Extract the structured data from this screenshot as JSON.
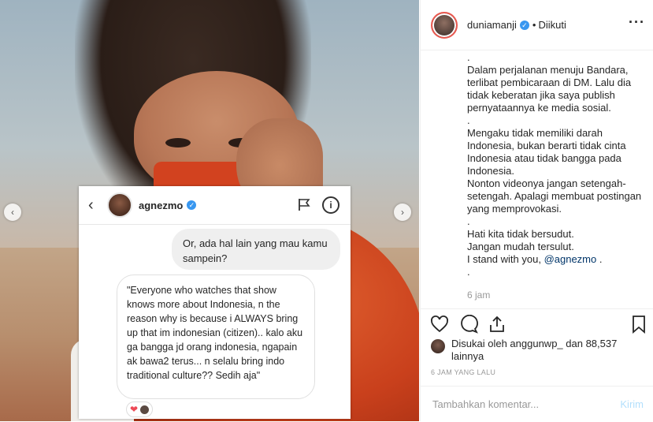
{
  "dm_screenshot": {
    "username": "agnezmo",
    "outgoing_message": "Or, ada hal lain yang mau kamu sampein?",
    "incoming_message": "\"Everyone who watches that show knows more about Indonesia, n the reason why is because i ALWAYS bring up that im indonesian (citizen).. kalo aku ga bangga jd orang indonesia, ngapain ak bawa2 terus... n selalu bring indo traditional culture?? Sedih aja\"",
    "icons": [
      "chevron-left-icon",
      "flag-icon",
      "info-icon",
      "heart-icon"
    ]
  },
  "post_header": {
    "username": "duniamanji",
    "separator": "•",
    "follow_status": "Diikuti",
    "more": "···"
  },
  "caption": {
    "text": ".\nDalam perjalanan menuju Bandara, terlibat pembicaraan di DM. Lalu dia tidak keberatan jika saya publish pernyataannya ke media sosial.\n.\nMengaku tidak memiliki darah Indonesia, bukan berarti tidak cinta Indonesia atau tidak bangga pada Indonesia.\nNonton videonya jangan setengah-setengah. Apalagi membuat postingan yang memprovokasi.\n.\nHati kita tidak bersudut.\nJangan mudah tersulut.\nI stand with you, ",
    "mention": "@agnezmo",
    "end": " .\n.",
    "time": "6 jam"
  },
  "likes": {
    "text": "Disukai oleh anggunwp_ dan 88,537 lainnya"
  },
  "timestamp": "6 JAM YANG LALU",
  "comment": {
    "placeholder": "Tambahkan komentar...",
    "post_label": "Kirim"
  },
  "colors": {
    "verified": "#3897f0",
    "mention": "#003569",
    "heart": "#ed4956",
    "post_disabled": "#b2dffc"
  }
}
